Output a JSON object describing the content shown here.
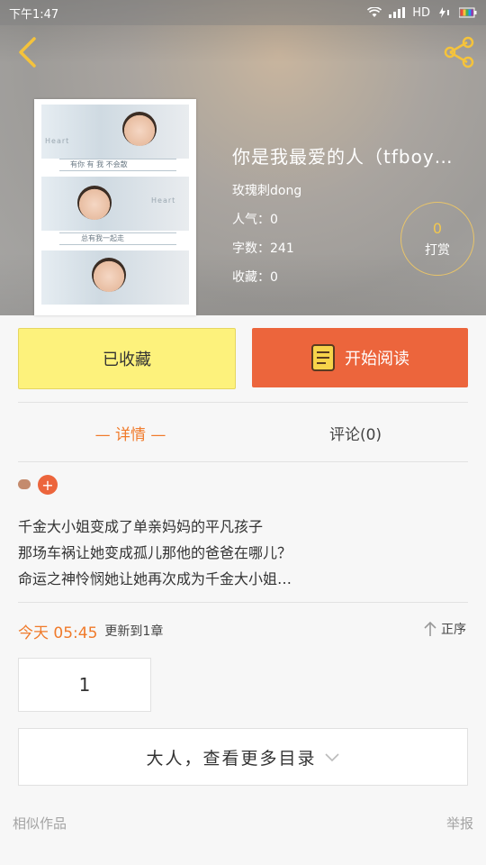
{
  "status_bar": {
    "time": "下午1:47",
    "network": "HD"
  },
  "book": {
    "title": "你是我最爱的人（tfboy…",
    "author": "玫瑰刺dong",
    "popularity": "人气：0",
    "word_count": "字数：241",
    "favorites": "收藏：0",
    "tip_count": "0",
    "tip_label": "打赏"
  },
  "actions": {
    "collected_label": "已收藏",
    "read_label": "开始阅读"
  },
  "tabs": {
    "detail": "— 详情 —",
    "comments": "评论(0)"
  },
  "summary": [
    "千金大小姐变成了单亲妈妈的平凡孩子",
    "那场车祸让她变成孤儿那他的爸爸在哪儿？",
    "命运之神怜悯她让她再次成为千金大小姐…"
  ],
  "tags": {
    "add_symbol": "+"
  },
  "update": {
    "date": "今天 05:45",
    "text": "更新到1章",
    "sort_label": "正序"
  },
  "chapters": {
    "first": "1"
  },
  "toc": {
    "more_label": "大人，查看更多目录"
  },
  "footer": {
    "similar": "相似作品",
    "report": "举报"
  },
  "colors": {
    "accent_orange": "#ec653c",
    "collected_yellow": "#fdf27c",
    "tip_gold": "#f3c84d"
  },
  "cover_art": {
    "watermark": "Heart",
    "captions": [
      "有你 有 我 不会散",
      "总有我一起走"
    ]
  }
}
